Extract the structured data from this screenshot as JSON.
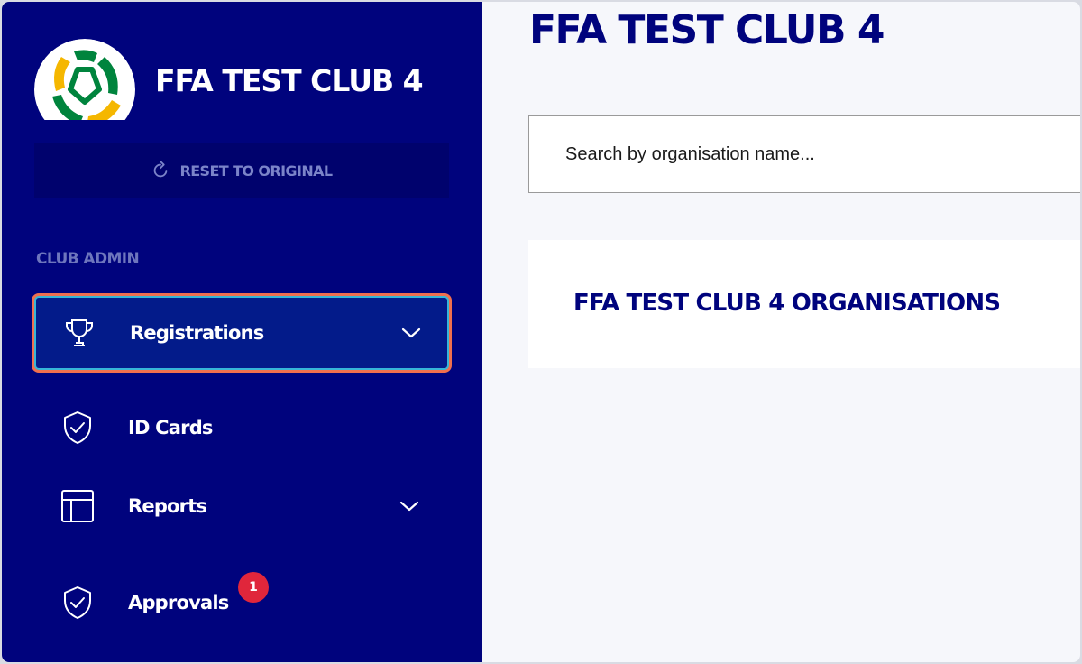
{
  "sidebar": {
    "club_name": "FFA TEST CLUB 4",
    "logo_icon": "football-australia-logo",
    "reset_label": "RESET TO ORIGINAL",
    "section_label": "CLUB ADMIN",
    "items": [
      {
        "label": "Registrations",
        "icon": "trophy-icon",
        "has_chevron": true,
        "active": true
      },
      {
        "label": "ID Cards",
        "icon": "shield-check-icon",
        "has_chevron": false
      },
      {
        "label": "Reports",
        "icon": "table-layout-icon",
        "has_chevron": true
      },
      {
        "label": "Approvals",
        "icon": "shield-check-icon",
        "has_chevron": false,
        "badge": "1"
      }
    ]
  },
  "main": {
    "page_title": "FFA TEST CLUB 4",
    "search_placeholder": "Search by organisation name...",
    "org_card_title": "FFA TEST CLUB 4 ORGANISATIONS"
  },
  "colors": {
    "sidebar_bg": "#00037d",
    "active_item_bg": "#031b8a",
    "active_border": "#36b6d8",
    "focus_ring": "#f06f4e",
    "badge": "#e0263b",
    "logo_green": "#00843d",
    "logo_gold": "#f5b700"
  }
}
